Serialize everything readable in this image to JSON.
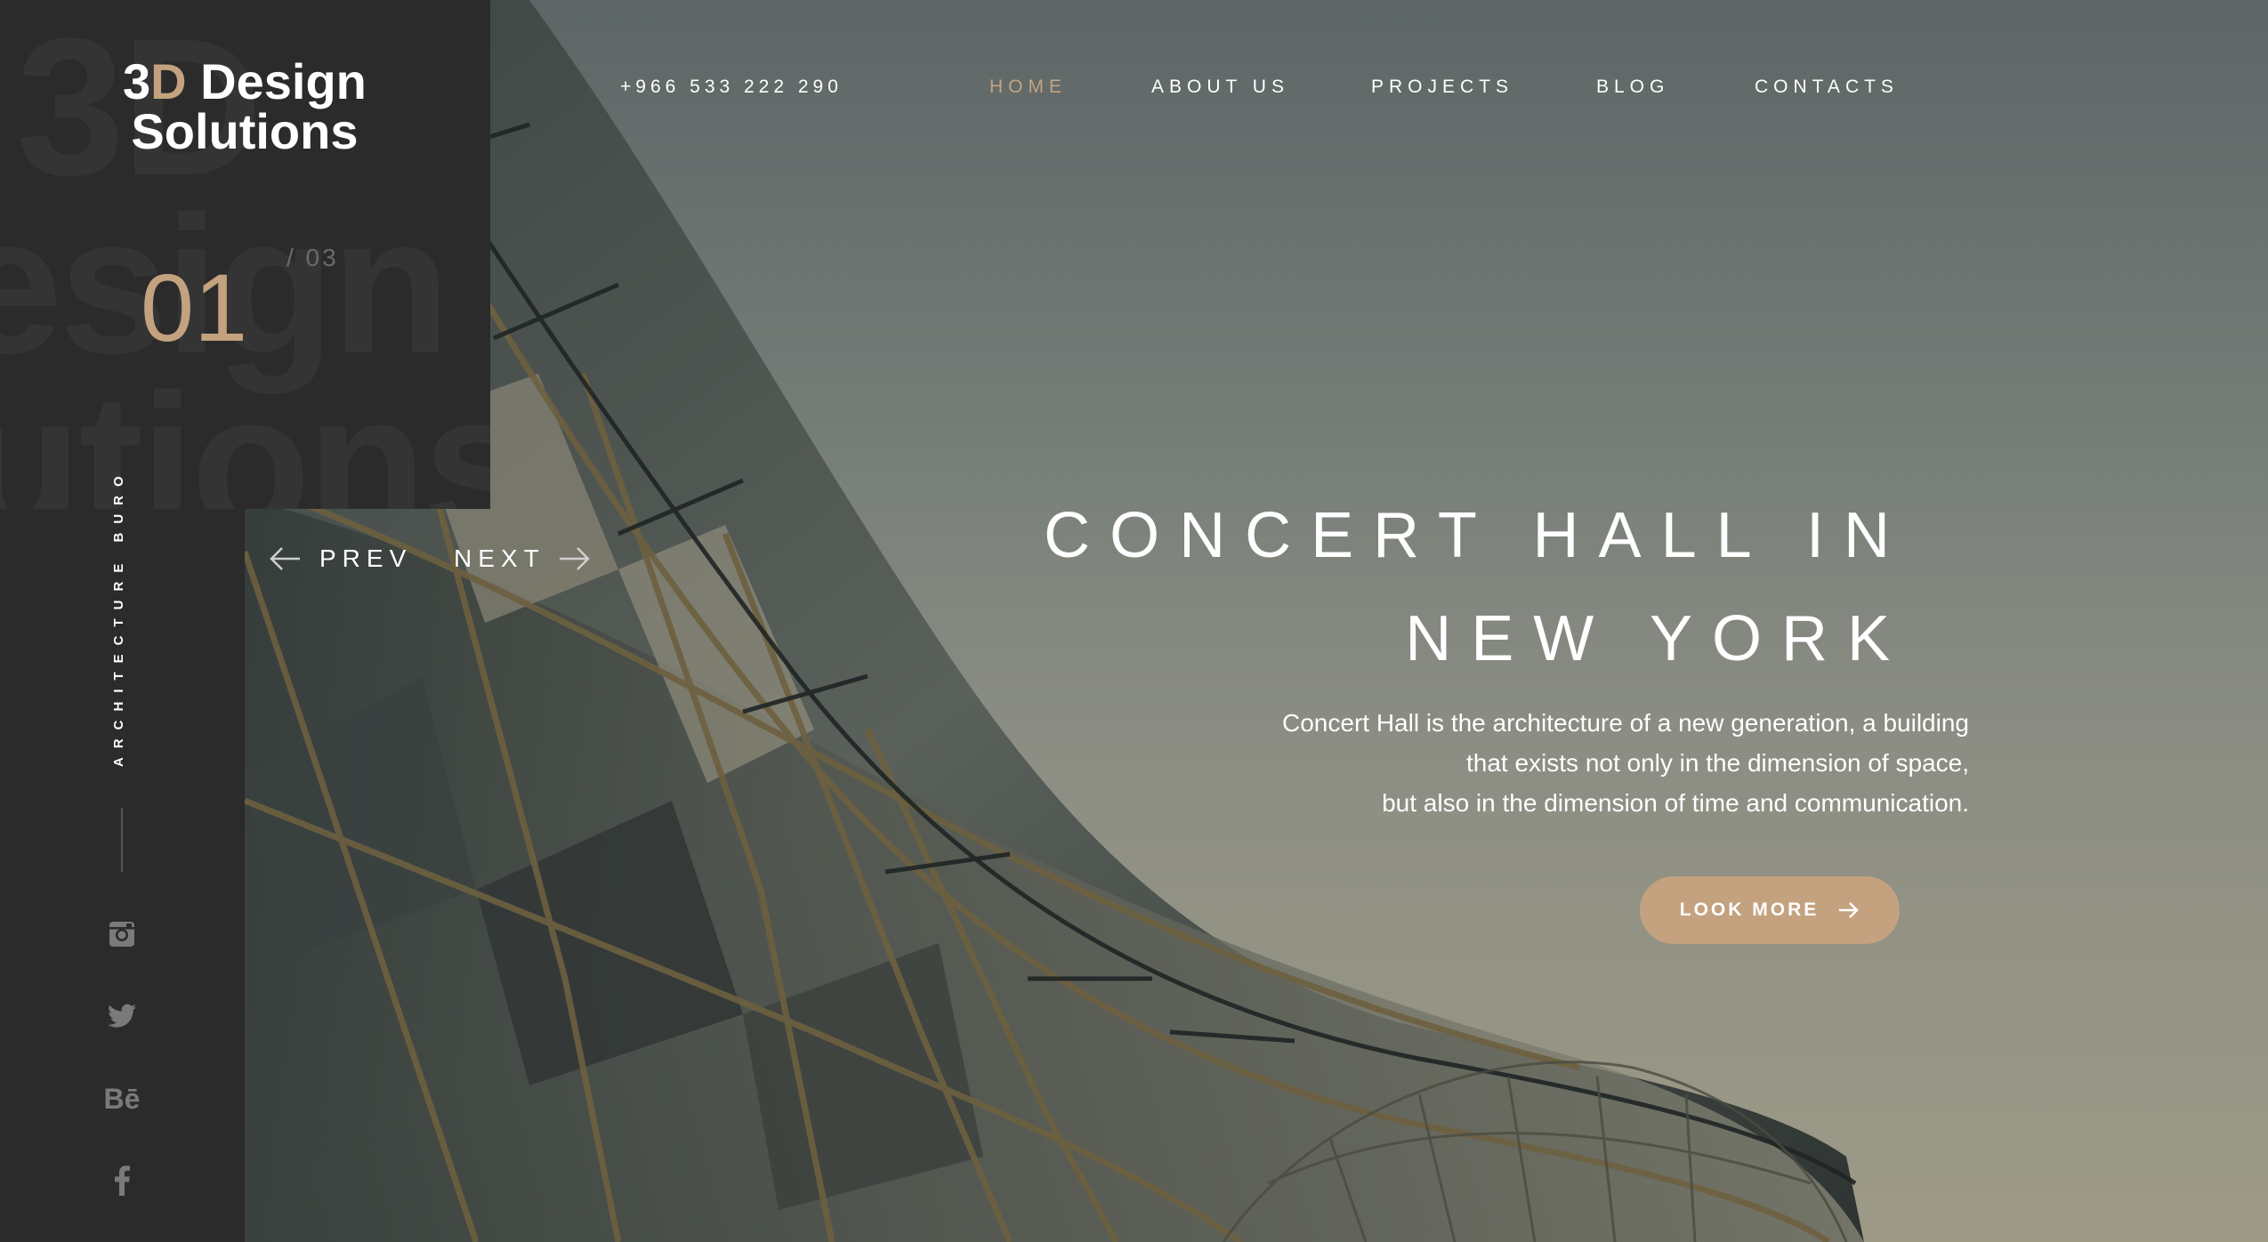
{
  "brand": {
    "logo_prefix": "3",
    "logo_accent": "D",
    "logo_line1_rest": " Design",
    "logo_line2": "Solutions",
    "watermark": [
      "3D",
      "esign",
      "utions"
    ]
  },
  "slider": {
    "current": "01",
    "total": "/  03",
    "prev_label": "PREV",
    "next_label": "NEXT"
  },
  "sidebar": {
    "vertical_label": "ARCHITECTURE BURO",
    "social": [
      "instagram-icon",
      "twitter-icon",
      "behance-icon",
      "facebook-icon"
    ],
    "behance_text": "Bē"
  },
  "header": {
    "phone": "+966 533 222 290",
    "nav": [
      {
        "label": "HOME",
        "active": true
      },
      {
        "label": "ABOUT US",
        "active": false
      },
      {
        "label": "PROJECTS",
        "active": false
      },
      {
        "label": "BLOG",
        "active": false
      },
      {
        "label": "CONTACTS",
        "active": false
      }
    ]
  },
  "hero": {
    "title_line1": "CONCERT HALL IN",
    "title_line2": "NEW YORK",
    "description": [
      "Concert Hall is the architecture of a new generation, a building",
      "that exists not only in the dimension of space,",
      "but also in the dimension of time and communication."
    ],
    "cta_label": "LOOK MORE"
  },
  "colors": {
    "accent": "#c4a27f",
    "sidebar_bg": "#2b2b2b",
    "text": "#ffffff"
  }
}
